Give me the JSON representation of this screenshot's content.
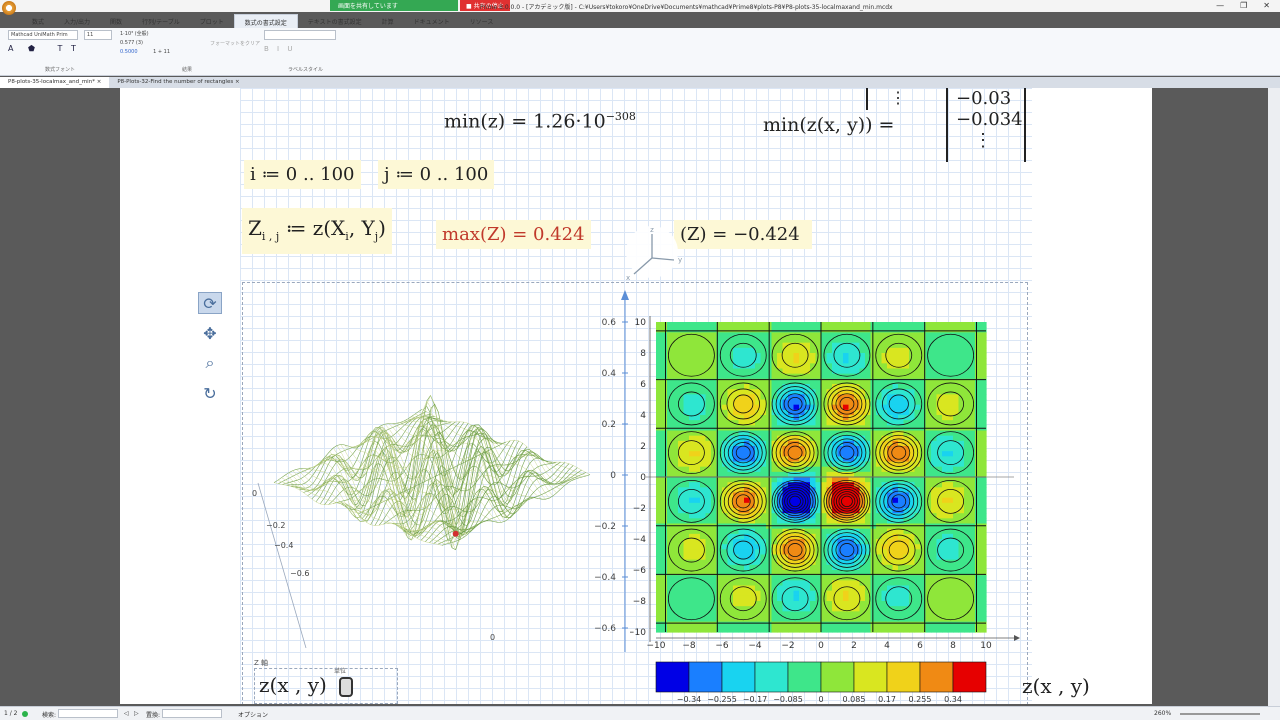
{
  "window": {
    "title": "Prime 8.0.0.0 - [アカデミック版] - C:¥Users¥tokoro¥OneDrive¥Documents¥mathcad¥Prime8¥plots-P8¥P8-plots-35-localmaxand_min.mcdx",
    "share_label": "画面を共有しています",
    "share_stop": "■ 共有の停止"
  },
  "ribbon_tabs": [
    "数式",
    "入力/出力",
    "関数",
    "行列/テーブル",
    "プロット",
    "数式の書式設定",
    "テキストの書式設定",
    "計算",
    "ドキュメント",
    "リソース"
  ],
  "ribbon": {
    "font_name": "Mathcad UniMath Prim",
    "font_size": "11",
    "number_format": "1·10³ (全般)",
    "precision": "0.577 (3)",
    "sample1": "0.5000",
    "sample2": "1 + 11",
    "format_group_label": "数式フォント",
    "bullet_group_label": "結果",
    "style_group_label": "ラベルスタイル",
    "apply_format": "フォーマットをクリア"
  },
  "doc_tabs": [
    "P8-plots-35-localmax_and_min*",
    "P8-Plots-32-Find the number of rectangles"
  ],
  "worksheet": {
    "min_z": "min(z) = 1.26·10",
    "min_z_exp": "−308",
    "min_zxy": "min(z(x, y)) =",
    "matrix_vals": [
      "−0.03",
      "−0.034",
      "⋮"
    ],
    "dots": "⋮",
    "i_def": "i ≔ 0 .. 100",
    "j_def": "j ≔ 0 .. 100",
    "Z_def": "Z",
    "Z_sub": "i , j",
    "Z_rhs": "≔ z(X",
    "X_sub": "i",
    "Y_mid": ", Y",
    "Y_sub": "j",
    "close": ")",
    "max_Z": "max(Z) = 0.424",
    "min_Z": "(Z) = −0.424",
    "plot_label": "z(x , y)",
    "z_axis_label": "Z 軸",
    "unit_label": "単位",
    "contour_label": "z(x , y)"
  },
  "chart_data": [
    {
      "type": "line",
      "title": "",
      "xlabel": "",
      "ylabel": "",
      "y_ticks": [
        "0.6",
        "0.4",
        "0.2",
        "0",
        "−0.2",
        "−0.4",
        "−0.6"
      ],
      "ylim": [
        -0.6,
        0.6
      ],
      "surface_z_ticks": [
        "0",
        "−0.2",
        "−0.4",
        "−0.6",
        "0"
      ]
    },
    {
      "type": "heatmap",
      "title": "",
      "x_ticks": [
        "−10",
        "−8",
        "−6",
        "−4",
        "−2",
        "0",
        "2",
        "4",
        "6",
        "8",
        "10"
      ],
      "y_ticks": [
        "10",
        "8",
        "6",
        "4",
        "2",
        "0",
        "−2",
        "−4",
        "−6",
        "−8",
        "−10"
      ],
      "xlim": [
        -10,
        10
      ],
      "ylim": [
        -10,
        10
      ],
      "colorbar_labels": [
        "−0.34",
        "−0.255",
        "−0.17",
        "−0.085",
        "0",
        "0.085",
        "0.17",
        "0.255",
        "0.34"
      ],
      "colorbar_colors": [
        "#0000e6",
        "#1a7fff",
        "#19d3f0",
        "#2ee6d0",
        "#3ee68a",
        "#8fe63a",
        "#d9e620",
        "#f0d21a",
        "#f08a14",
        "#e60000"
      ]
    }
  ],
  "status": {
    "page": "1 / 2",
    "search_label": "検索:",
    "replace_label": "置換:",
    "options": "オプション",
    "zoom": "260%"
  }
}
